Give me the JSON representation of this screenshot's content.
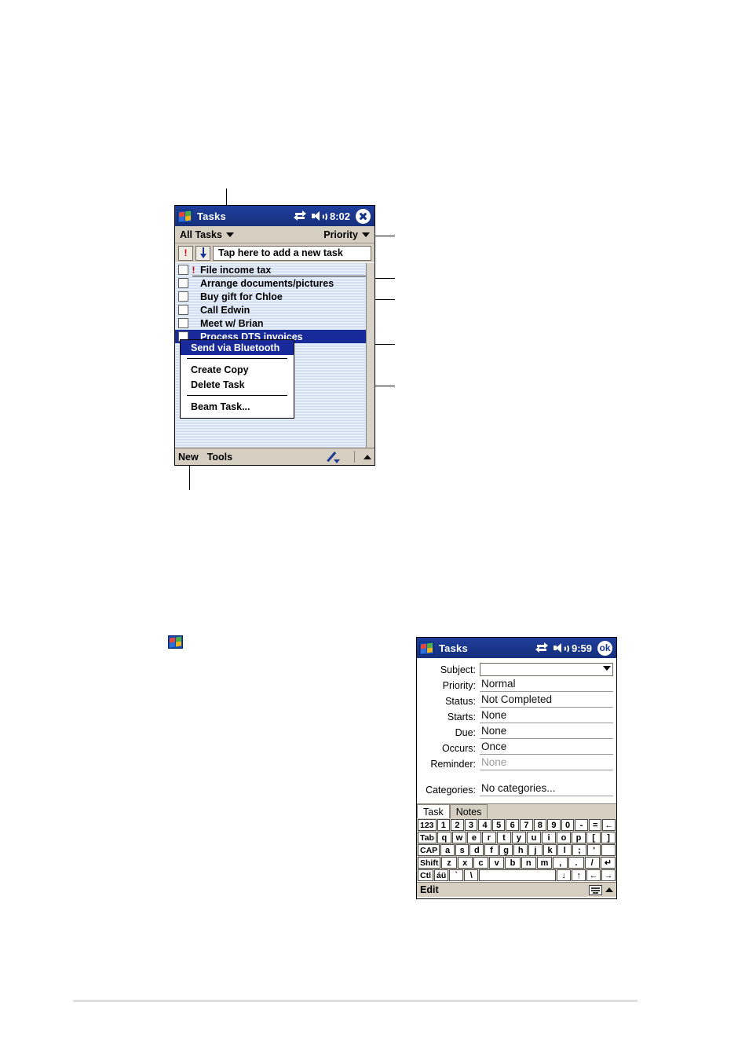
{
  "device_tasks_list": {
    "titlebar": {
      "app_title": "Tasks",
      "clock": "8:02",
      "start_icon": "windows-logo-icon",
      "connectivity_icon": "connectivity-icon",
      "volume_icon": "speaker-icon",
      "close_label": "x"
    },
    "filterbar": {
      "category_filter": "All Tasks",
      "sort_filter": "Priority"
    },
    "newtask": {
      "priority_button": "!",
      "sort_button": "down-arrow",
      "placeholder": "Tap here to add a new task"
    },
    "tasks": [
      {
        "label": "File income tax",
        "priority": "!",
        "checked": false,
        "selected": false
      },
      {
        "label": "Arrange documents/pictures",
        "priority": "",
        "checked": false,
        "selected": false
      },
      {
        "label": "Buy gift for Chloe",
        "priority": "",
        "checked": false,
        "selected": false
      },
      {
        "label": "Call Edwin",
        "priority": "",
        "checked": false,
        "selected": false
      },
      {
        "label": "Meet w/ Brian",
        "priority": "",
        "checked": false,
        "selected": false
      },
      {
        "label": "Process DTS invoices",
        "priority": "",
        "checked": false,
        "selected": true
      }
    ],
    "context_menu": {
      "items": [
        {
          "label": "Send via Bluetooth",
          "highlighted": true,
          "separator_after": true
        },
        {
          "label": "Create Copy",
          "highlighted": false,
          "separator_after": false
        },
        {
          "label": "Delete Task",
          "highlighted": false,
          "separator_after": true
        },
        {
          "label": "Beam Task...",
          "highlighted": false,
          "separator_after": false
        }
      ]
    },
    "commandbar": {
      "new_label": "New",
      "tools_label": "Tools",
      "pen_icon": "pen-icon",
      "expand_icon": "chevron-up-icon"
    }
  },
  "device_task_form": {
    "titlebar": {
      "app_title": "Tasks",
      "clock": "9:59",
      "start_icon": "windows-logo-icon",
      "connectivity_icon": "connectivity-icon",
      "volume_icon": "speaker-icon",
      "ok_label": "ok"
    },
    "fields": [
      {
        "label": "Subject:",
        "value": "",
        "type": "combo",
        "muted": false
      },
      {
        "label": "Priority:",
        "value": "Normal",
        "type": "line",
        "muted": false
      },
      {
        "label": "Status:",
        "value": "Not Completed",
        "type": "line",
        "muted": false
      },
      {
        "label": "Starts:",
        "value": "None",
        "type": "line",
        "muted": false
      },
      {
        "label": "Due:",
        "value": "None",
        "type": "line",
        "muted": false
      },
      {
        "label": "Occurs:",
        "value": "Once",
        "type": "line",
        "muted": false
      },
      {
        "label": "Reminder:",
        "value": "None",
        "type": "line",
        "muted": true
      },
      {
        "label": "Categories:",
        "value": "No categories...",
        "type": "line",
        "muted": false
      }
    ],
    "tabs": [
      {
        "label": "Task",
        "active": true
      },
      {
        "label": "Notes",
        "active": false
      }
    ],
    "keyboard": {
      "rows": [
        [
          "123",
          "1",
          "2",
          "3",
          "4",
          "5",
          "6",
          "7",
          "8",
          "9",
          "0",
          "-",
          "=",
          "←"
        ],
        [
          "Tab",
          "q",
          "w",
          "e",
          "r",
          "t",
          "y",
          "u",
          "i",
          "o",
          "p",
          "[",
          "]"
        ],
        [
          "CAP",
          "a",
          "s",
          "d",
          "f",
          "g",
          "h",
          "j",
          "k",
          "l",
          ";",
          "'"
        ],
        [
          "Shift",
          "z",
          "x",
          "c",
          "v",
          "b",
          "n",
          "m",
          ",",
          ".",
          "/",
          "↵"
        ],
        [
          "Ctl",
          "áü",
          "`",
          "\\",
          " ",
          "↓",
          "↑",
          "←",
          "→"
        ]
      ]
    },
    "statusbar": {
      "edit_label": "Edit",
      "keyboard_icon": "keyboard-icon",
      "expand_icon": "chevron-up-icon"
    }
  },
  "figure": {
    "stray_start_icon": "windows-logo-icon"
  }
}
